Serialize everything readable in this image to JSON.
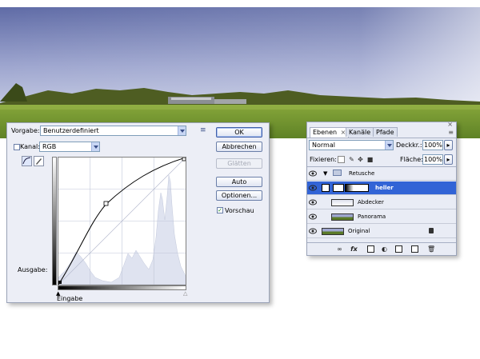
{
  "curves": {
    "preset_label": "Vorgabe:",
    "preset_value": "Benutzerdefiniert",
    "channel_label": "Kanal:",
    "channel_value": "RGB",
    "output_label": "Ausgabe:",
    "input_label": "Eingabe",
    "buttons": {
      "ok": "OK",
      "cancel": "Abbrechen",
      "smooth": "Glätten",
      "auto": "Auto",
      "options": "Optionen..."
    },
    "preview_label": "Vorschau",
    "preview_checked": true,
    "tools": [
      "curve-point-icon",
      "pencil-icon"
    ]
  },
  "layers": {
    "tabs": [
      {
        "label": "Ebenen",
        "active": true
      },
      {
        "label": "Kanäle",
        "active": false
      },
      {
        "label": "Pfade",
        "active": false
      }
    ],
    "blend_mode": "Normal",
    "opacity_label": "Deckkr.:",
    "opacity_value": "100%",
    "lock_label": "Fixieren:",
    "fill_label": "Fläche:",
    "fill_value": "100%",
    "items": [
      {
        "name": "Retusche",
        "type": "group",
        "selected": false
      },
      {
        "name": "heller",
        "type": "adjustment",
        "selected": true
      },
      {
        "name": "Abdecker",
        "type": "layer",
        "selected": false
      },
      {
        "name": "Panorama",
        "type": "layer",
        "selected": false
      },
      {
        "name": "Original",
        "type": "background",
        "selected": false,
        "locked": true
      }
    ],
    "footer_icons": [
      "link-icon",
      "fx-icon",
      "mask-icon",
      "adjustment-icon",
      "folder-icon",
      "new-layer-icon",
      "trash-icon"
    ]
  },
  "colors": {
    "selection": "#3264d6",
    "dialog_bg": "#eceef6",
    "histogram": "#dfe3f0"
  }
}
